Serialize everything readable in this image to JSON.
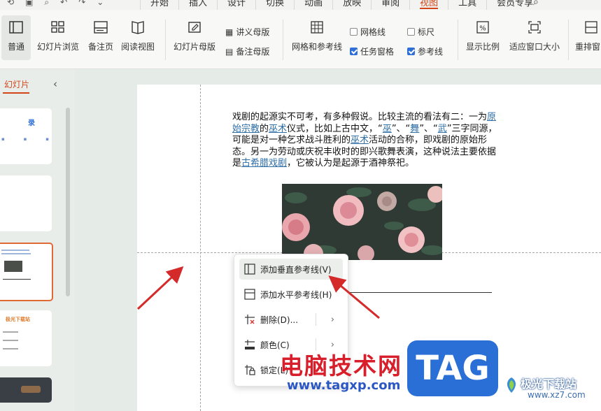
{
  "menu": {
    "tabs": [
      {
        "label": "开始"
      },
      {
        "label": "插入"
      },
      {
        "label": "设计"
      },
      {
        "label": "切换"
      },
      {
        "label": "动画"
      },
      {
        "label": "放映"
      },
      {
        "label": "审阅"
      },
      {
        "label": "视图"
      },
      {
        "label": "工具"
      },
      {
        "label": "会员专享"
      }
    ],
    "active_tab": "视图"
  },
  "ribbon": {
    "normal": "普通",
    "slide_browse": "幻灯片浏览",
    "notes_page": "备注页",
    "reading_view": "阅读视图",
    "slide_master": "幻灯片母版",
    "handout_master": "讲义母版",
    "notes_master": "备注母版",
    "grid_guides": "网格和参考线",
    "gridlines": "网格线",
    "ruler": "标尺",
    "task_pane": "任务窗格",
    "guides": "参考线",
    "zoom": "显示比例",
    "fit_window": "适应窗口大小",
    "rearrange": "重排窗"
  },
  "checkboxes": {
    "gridlines": false,
    "ruler": false,
    "task_pane": true,
    "guides": true
  },
  "panel": {
    "title": "幻灯片",
    "thumb1_title": "录",
    "thumb4_title": "极光下载站"
  },
  "slide": {
    "t1": "戏剧的起源实不可考，有多种假说。比较主流的看法有二：一为",
    "l1": "原始宗教",
    "t2": "的",
    "l2": "巫术",
    "t3": "仪式，比如上古中文，“",
    "l3": "巫",
    "t4": "”、“",
    "l4": "舞",
    "t5": "”、“",
    "l5": "武",
    "t6": "”三字同源，可能是对一种乞求战斗胜利的",
    "l6": "巫术",
    "t7": "活动的合称，即戏剧的原始形态。另一为劳动或庆祝丰收时的即兴歌舞表演，这种说法主要依据是",
    "l7": "古希腊戏剧",
    "t8": "，它被认为是起源于酒神祭祀。"
  },
  "context_menu": {
    "add_vertical": "添加垂直参考线(V)",
    "add_horizontal": "添加水平参考线(H)",
    "delete": "删除(D)...",
    "color": "颜色(C)",
    "lock": "锁定(L)"
  },
  "watermark": {
    "site_name": "电脑技术网",
    "url": "www.tagxp.com",
    "tag": "TAG",
    "xz_name": "极光下载站",
    "xz_url": "www.xz7.com"
  },
  "colors": {
    "accent": "#d2461a",
    "link": "#2f6fa8",
    "arrow": "#d42a2a",
    "checkbox": "#2f6fd6"
  }
}
